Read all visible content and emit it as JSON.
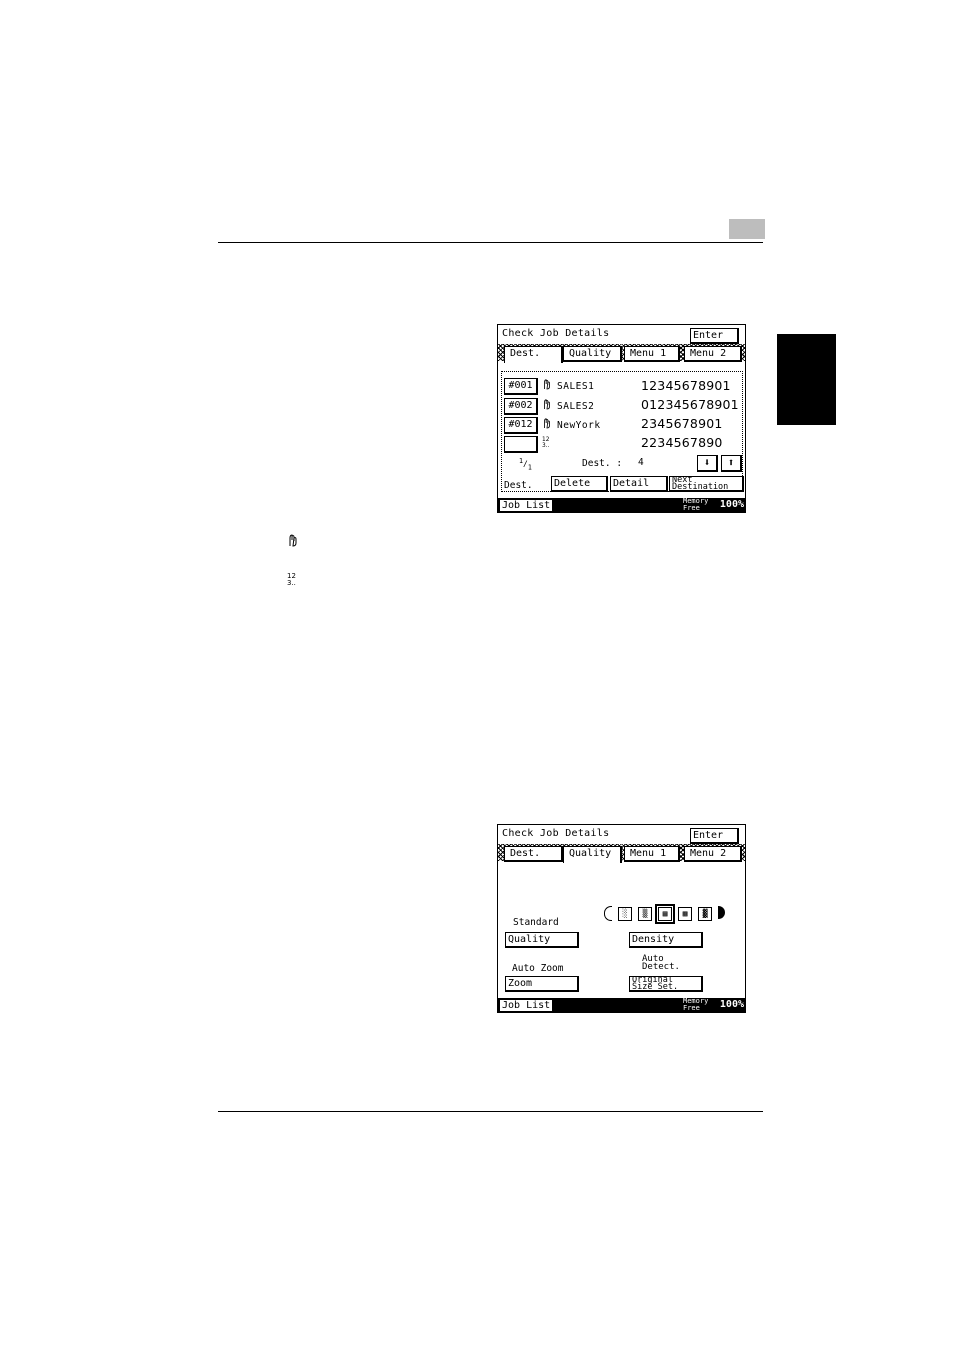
{
  "page": {
    "legend_icons": [
      "hand-icon",
      "ordinal-icon"
    ]
  },
  "screen1": {
    "title": "Check Job Details",
    "enter": "Enter",
    "tabs": [
      "Dest.",
      "Quality",
      "Menu 1",
      "Menu 2"
    ],
    "rows": [
      {
        "button": "#001",
        "icon": "hand-icon",
        "name": "SALES1",
        "number": "12345678901"
      },
      {
        "button": "#002",
        "icon": "hand-icon",
        "name": "SALES2",
        "number": "012345678901"
      },
      {
        "button": "#012",
        "icon": "hand-icon",
        "name": "NewYork",
        "number": "2345678901"
      },
      {
        "button": "",
        "icon": "ordinal-icon",
        "name": "",
        "number": "2234567890"
      }
    ],
    "page_indicator_top": "1",
    "page_indicator_bottom": "1",
    "dest_count_label": "Dest. :",
    "dest_count": "4",
    "dest_label": "Dest.",
    "delete": "Delete",
    "detail": "Detail",
    "next_dest_line1": "Next",
    "next_dest_line2": "Destination",
    "job_list": "Job List",
    "memory_line1": "Memory",
    "memory_line2": "Free",
    "memory_pct": "100%"
  },
  "screen2": {
    "title": "Check Job Details",
    "enter": "Enter",
    "tabs": [
      "Dest.",
      "Quality",
      "Menu 1",
      "Menu 2"
    ],
    "standard_label": "Standard",
    "quality_btn": "Quality",
    "density_btn": "Density",
    "auto_zoom_label": "Auto Zoom",
    "zoom_btn": "Zoom",
    "auto_detect_line1": "Auto",
    "auto_detect_line2": "Detect.",
    "orig_line1": "Original",
    "orig_line2": "Size Set.",
    "density_selected_index": 3,
    "job_list": "Job List",
    "memory_line1": "Memory",
    "memory_line2": "Free",
    "memory_pct": "100%"
  }
}
